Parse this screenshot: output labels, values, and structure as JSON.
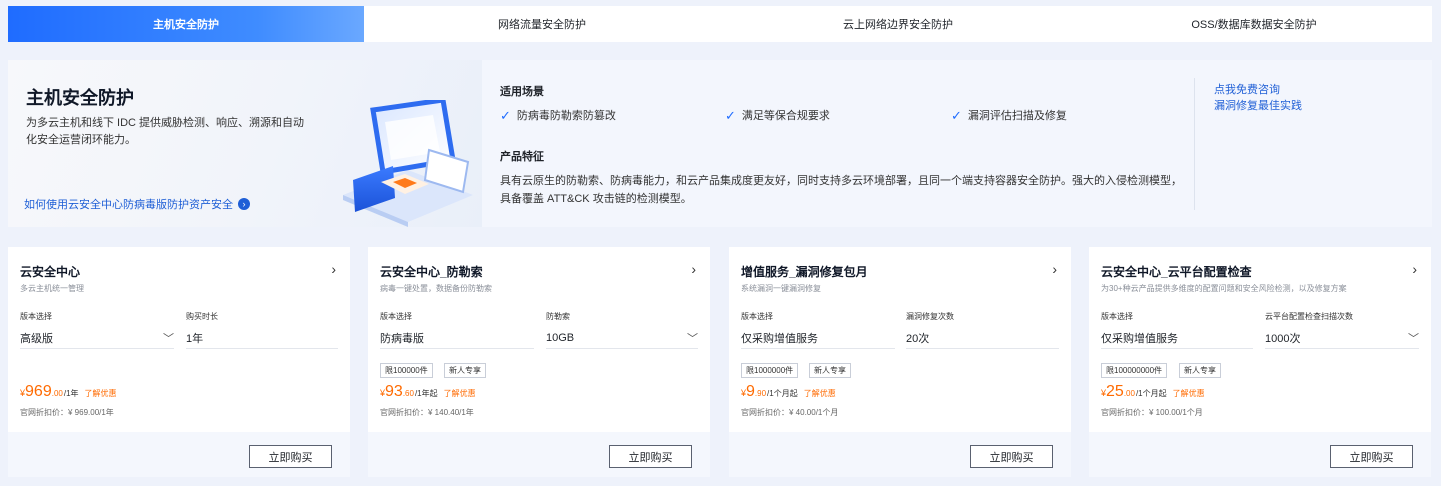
{
  "tabs": [
    {
      "label": "主机安全防护",
      "active": true
    },
    {
      "label": "网络流量安全防护",
      "active": false
    },
    {
      "label": "云上网络边界安全防护",
      "active": false
    },
    {
      "label": "OSS/数据库数据安全防护",
      "active": false
    }
  ],
  "hero": {
    "title": "主机安全防护",
    "description": "为多云主机和线下 IDC 提供威胁检测、响应、溯源和自动化安全运营闭环能力。",
    "link": "如何使用云安全中心防病毒版防护资产安全",
    "scenarios_title": "适用场景",
    "scenarios": [
      "防病毒防勒索防篡改",
      "满足等保合规要求",
      "漏洞评估扫描及修复"
    ],
    "features_title": "产品特征",
    "features_text": "具有云原生的防勒索、防病毒能力，和云产品集成度更友好，同时支持多云环境部署，且同一个端支持容器安全防护。强大的入侵检测模型，具备覆盖 ATT&CK 攻击链的检测模型。",
    "side_links": [
      "点我免费咨询",
      "漏洞修复最佳实践"
    ]
  },
  "colors": {
    "accent": "#1f6cff",
    "price": "#ff6a00",
    "link": "#1f5fd6"
  },
  "cards": [
    {
      "title": "云安全中心",
      "subtitle": "多云主机统一管理",
      "opt1_label": "版本选择",
      "opt1_value": "高级版",
      "opt2_label": "购买时长",
      "opt2_value": "1年",
      "price_currency": "¥",
      "price_int": "969",
      "price_dec": ".00",
      "price_unit": "/1年",
      "discount": "了解优惠",
      "original": "官网折扣价：¥ 969.00/1年",
      "buy": "立即购买"
    },
    {
      "title": "云安全中心_防勒索",
      "subtitle": "病毒一键处置，数据备份防勒索",
      "opt1_label": "版本选择",
      "opt1_value": "防病毒版",
      "opt2_label": "防勒索",
      "opt2_value": "10GB",
      "tag1": "限100000件",
      "tag2": "新人专享",
      "price_currency": "¥",
      "price_int": "93",
      "price_dec": ".60",
      "price_unit": "/1年起",
      "discount": "了解优惠",
      "original": "官网折扣价：¥ 140.40/1年",
      "buy": "立即购买"
    },
    {
      "title": "增值服务_漏洞修复包月",
      "subtitle": "系统漏洞一键漏洞修复",
      "opt1_label": "版本选择",
      "opt1_value": "仅采购增值服务",
      "opt2_label": "漏洞修复次数",
      "opt2_value": "20次",
      "tag1": "限1000000件",
      "tag2": "新人专享",
      "price_currency": "¥",
      "price_int": "9",
      "price_dec": ".90",
      "price_unit": "/1个月起",
      "discount": "了解优惠",
      "original": "官网折扣价：¥ 40.00/1个月",
      "buy": "立即购买"
    },
    {
      "title": "云安全中心_云平台配置检查",
      "subtitle": "为30+种云产品提供多维度的配置问题和安全风险检测，以及修复方案",
      "opt1_label": "版本选择",
      "opt1_value": "仅采购增值服务",
      "opt2_label": "云平台配置检查扫描次数",
      "opt2_value": "1000次",
      "tag1": "限100000000件",
      "tag2": "新人专享",
      "price_currency": "¥",
      "price_int": "25",
      "price_dec": ".00",
      "price_unit": "/1个月起",
      "discount": "了解优惠",
      "original": "官网折扣价：¥ 100.00/1个月",
      "buy": "立即购买"
    }
  ]
}
